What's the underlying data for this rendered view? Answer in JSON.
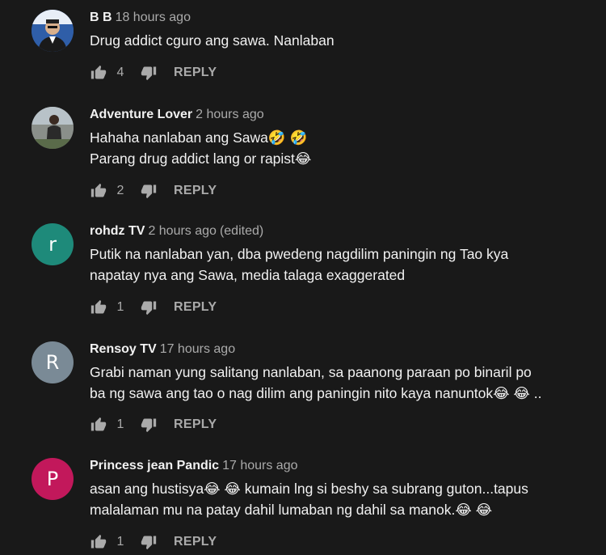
{
  "comments": [
    {
      "author": "B B",
      "time": "18 hours ago",
      "edited": "",
      "text": "Drug addict cguro ang sawa. Nanlaban",
      "likes": "4",
      "reply_label": "REPLY",
      "avatar": {
        "type": "photo",
        "letter": "",
        "color": "#2b4f8a"
      }
    },
    {
      "author": "Adventure Lover",
      "time": "2 hours ago",
      "edited": "",
      "text": "Hahaha nanlaban ang Sawa🤣 🤣\nParang drug addict lang or rapist😂",
      "likes": "2",
      "reply_label": "REPLY",
      "avatar": {
        "type": "photo",
        "letter": "",
        "color": "#6b6b6b"
      }
    },
    {
      "author": "rohdz TV",
      "time": "2 hours ago",
      "edited": "(edited)",
      "text": "Putik na nanlaban yan, dba pwedeng nagdilim paningin ng Tao kya\nnapatay nya ang Sawa, media talaga exaggerated",
      "likes": "1",
      "reply_label": "REPLY",
      "avatar": {
        "type": "letter",
        "letter": "r",
        "color": "#1e8a7a"
      }
    },
    {
      "author": "Rensoy TV",
      "time": "17 hours ago",
      "edited": "",
      "text": "Grabi naman yung salitang nanlaban, sa paanong paraan po binaril po\nba ng sawa ang tao o nag dilim ang paningin nito kaya nanuntok😂 😂 ..",
      "likes": "1",
      "reply_label": "REPLY",
      "avatar": {
        "type": "letter",
        "letter": "R",
        "color": "#7a8a96"
      }
    },
    {
      "author": "Princess jean Pandic",
      "time": "17 hours ago",
      "edited": "",
      "text": "asan ang hustisya😂 😂  kumain lng si beshy sa subrang guton...tapus\nmalalaman mu na patay dahil lumaban ng dahil sa manok.😂 😂",
      "likes": "1",
      "reply_label": "REPLY",
      "avatar": {
        "type": "letter",
        "letter": "P",
        "color": "#c2185b"
      }
    }
  ]
}
